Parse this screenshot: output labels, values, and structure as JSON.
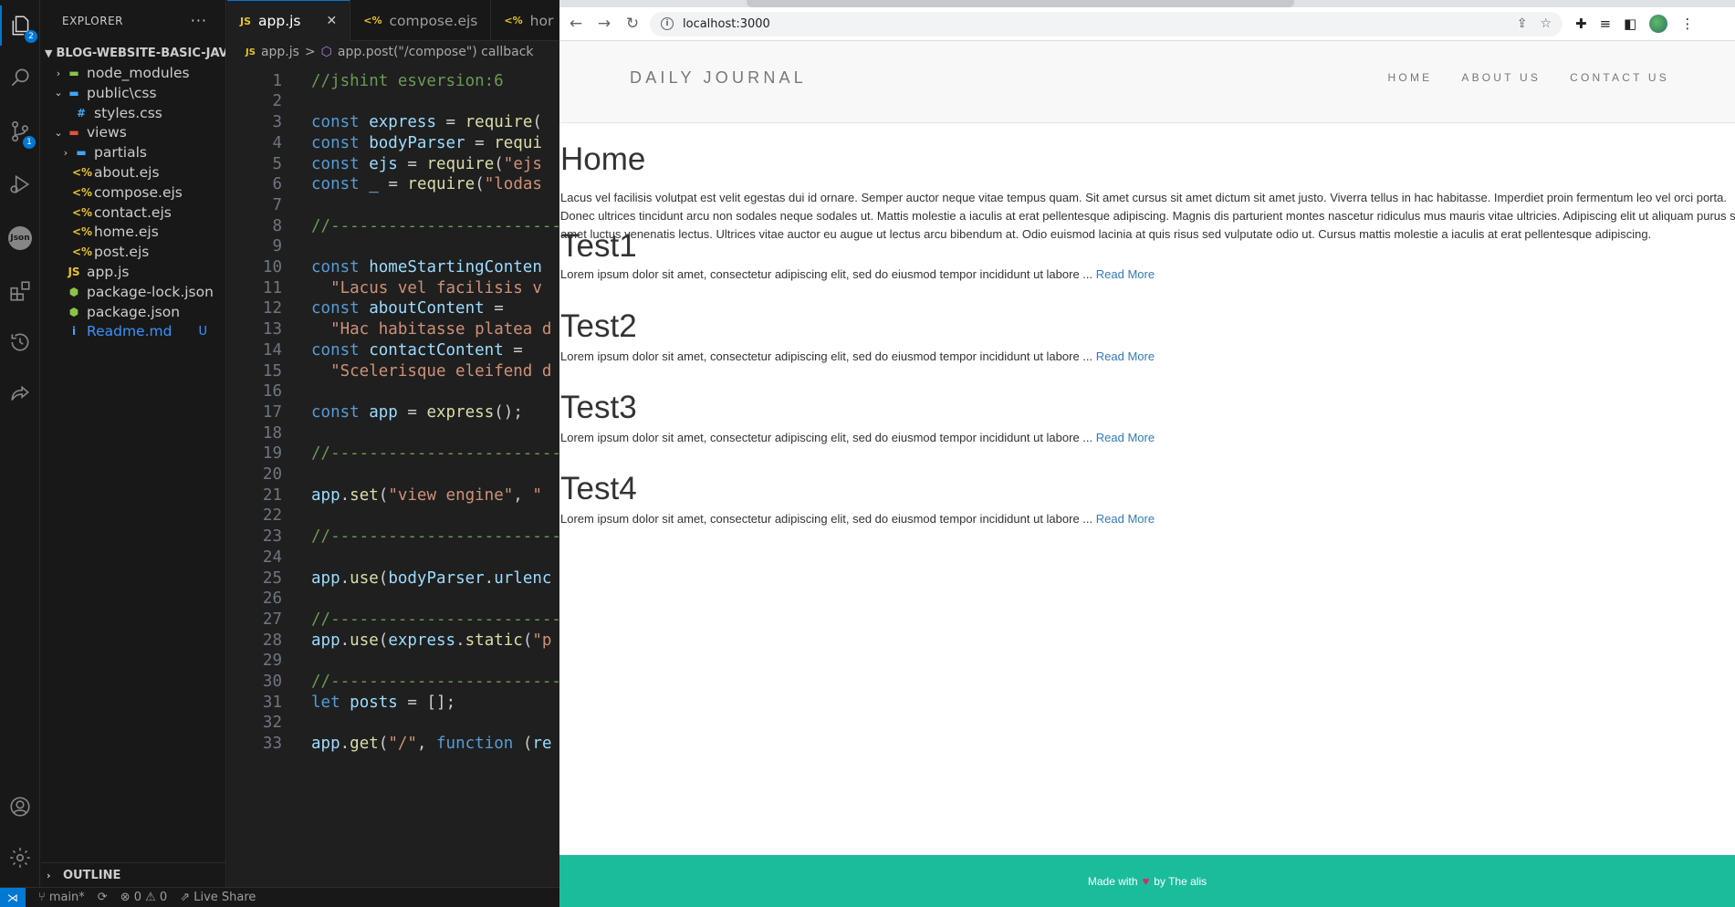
{
  "vscode": {
    "activity_badges": {
      "explorer": "2",
      "source_control": "1"
    },
    "json_label": "Json",
    "explorer_title": "EXPLORER",
    "more_actions": "···",
    "project": "BLOG-WEBSITE-BASIC-JAV...",
    "tree": [
      {
        "label": "node_modules",
        "kind": "folder",
        "icon": "folder-icon"
      },
      {
        "label": "public\\css",
        "kind": "folder",
        "icon": "folder-icon"
      },
      {
        "label": "styles.css",
        "kind": "file",
        "icon": "css-file-icon"
      },
      {
        "label": "views",
        "kind": "folder",
        "icon": "folder-icon"
      },
      {
        "label": "partials",
        "kind": "folder",
        "icon": "folder-icon"
      },
      {
        "label": "about.ejs",
        "kind": "file",
        "icon": "ejs-file-icon"
      },
      {
        "label": "compose.ejs",
        "kind": "file",
        "icon": "ejs-file-icon"
      },
      {
        "label": "contact.ejs",
        "kind": "file",
        "icon": "ejs-file-icon"
      },
      {
        "label": "home.ejs",
        "kind": "file",
        "icon": "ejs-file-icon"
      },
      {
        "label": "post.ejs",
        "kind": "file",
        "icon": "ejs-file-icon"
      },
      {
        "label": "app.js",
        "kind": "file",
        "icon": "js-file-icon"
      },
      {
        "label": "package-lock.json",
        "kind": "file",
        "icon": "json-file-icon"
      },
      {
        "label": "package.json",
        "kind": "file",
        "icon": "json-file-icon"
      },
      {
        "label": "Readme.md",
        "kind": "file",
        "icon": "info-icon",
        "badge": "U"
      }
    ],
    "outline_label": "OUTLINE",
    "tabs": [
      {
        "label": "app.js",
        "active": true,
        "icon_text": "JS",
        "close": "✕"
      },
      {
        "label": "compose.ejs",
        "active": false,
        "icon_text": "<%"
      },
      {
        "label": "hor",
        "active": false,
        "icon_text": "<%"
      }
    ],
    "breadcrumb": {
      "file": "app.js",
      "separator": ">",
      "symbol": "app.post(\"/compose\") callback"
    },
    "code_lines": [
      {
        "n": "1",
        "text": "//jshint esversion:6"
      },
      {
        "n": "2",
        "text": ""
      },
      {
        "n": "3",
        "text": "const express = require("
      },
      {
        "n": "4",
        "text": "const bodyParser = requi"
      },
      {
        "n": "5",
        "text": "const ejs = require(\"ejs"
      },
      {
        "n": "6",
        "text": "const _ = require(\"lodas"
      },
      {
        "n": "7",
        "text": ""
      },
      {
        "n": "8",
        "text": "//-------------------------"
      },
      {
        "n": "9",
        "text": ""
      },
      {
        "n": "10",
        "text": "const homeStartingConten"
      },
      {
        "n": "11",
        "text": "  \"Lacus vel facilisis v"
      },
      {
        "n": "12",
        "text": "const aboutContent ="
      },
      {
        "n": "13",
        "text": "  \"Hac habitasse platea d"
      },
      {
        "n": "14",
        "text": "const contactContent ="
      },
      {
        "n": "15",
        "text": "  \"Scelerisque eleifend d"
      },
      {
        "n": "16",
        "text": ""
      },
      {
        "n": "17",
        "text": "const app = express();"
      },
      {
        "n": "18",
        "text": ""
      },
      {
        "n": "19",
        "text": "//-------------------------"
      },
      {
        "n": "20",
        "text": ""
      },
      {
        "n": "21",
        "text": "app.set(\"view engine\", \""
      },
      {
        "n": "22",
        "text": ""
      },
      {
        "n": "23",
        "text": "//-------------------------"
      },
      {
        "n": "24",
        "text": ""
      },
      {
        "n": "25",
        "text": "app.use(bodyParser.urlenc"
      },
      {
        "n": "26",
        "text": ""
      },
      {
        "n": "27",
        "text": "//-------------------------"
      },
      {
        "n": "28",
        "text": "app.use(express.static(\"p"
      },
      {
        "n": "29",
        "text": ""
      },
      {
        "n": "30",
        "text": "//-------------------------"
      },
      {
        "n": "31",
        "text": "let posts = [];"
      },
      {
        "n": "32",
        "text": ""
      },
      {
        "n": "33",
        "text": "app.get(\"/\", function (re"
      }
    ],
    "status": {
      "branch": "main*",
      "problems": "⊗ 0 ⚠ 0",
      "live_share": "Live Share"
    }
  },
  "browser": {
    "url": "localhost:3000",
    "site": {
      "brand": "DAILY JOURNAL",
      "nav": [
        "HOME",
        "ABOUT US",
        "CONTACT US"
      ],
      "home_title": "Home",
      "home_text": "Lacus vel facilisis volutpat est velit egestas dui id ornare. Semper auctor neque vitae tempus quam. Sit amet cursus sit amet dictum sit amet justo. Viverra tellus in hac habitasse. Imperdiet proin fermentum leo vel orci porta. Donec ultrices tincidunt arcu non sodales neque sodales ut. Mattis molestie a iaculis at erat pellentesque adipiscing. Magnis dis parturient montes nascetur ridiculus mus mauris vitae ultricies. Adipiscing elit ut aliquam purus sit amet luctus venenatis lectus. Ultrices vitae auctor eu augue ut lectus arcu bibendum at. Odio euismod lacinia at quis risus sed vulputate odio ut. Cursus mattis molestie a iaculis at erat pellentesque adipiscing.",
      "posts": [
        {
          "title": "Test1",
          "excerpt": "Lorem ipsum dolor sit amet, consectetur adipiscing elit, sed do eiusmod tempor incididunt ut labore ...",
          "link": "Read More"
        },
        {
          "title": "Test2",
          "excerpt": "Lorem ipsum dolor sit amet, consectetur adipiscing elit, sed do eiusmod tempor incididunt ut labore ...",
          "link": "Read More"
        },
        {
          "title": "Test3",
          "excerpt": "Lorem ipsum dolor sit amet, consectetur adipiscing elit, sed do eiusmod tempor incididunt ut labore ...",
          "link": "Read More"
        },
        {
          "title": "Test4",
          "excerpt": "Lorem ipsum dolor sit amet, consectetur adipiscing elit, sed do eiusmod tempor incididunt ut labore ...",
          "link": "Read More"
        }
      ],
      "footer": {
        "before": "Made with",
        "heart": "♥",
        "after": "by The alis"
      }
    }
  },
  "colors": {
    "vscode_accent": "#0078d4",
    "link": "#337ab7",
    "footer_bg": "#1abc9c"
  }
}
